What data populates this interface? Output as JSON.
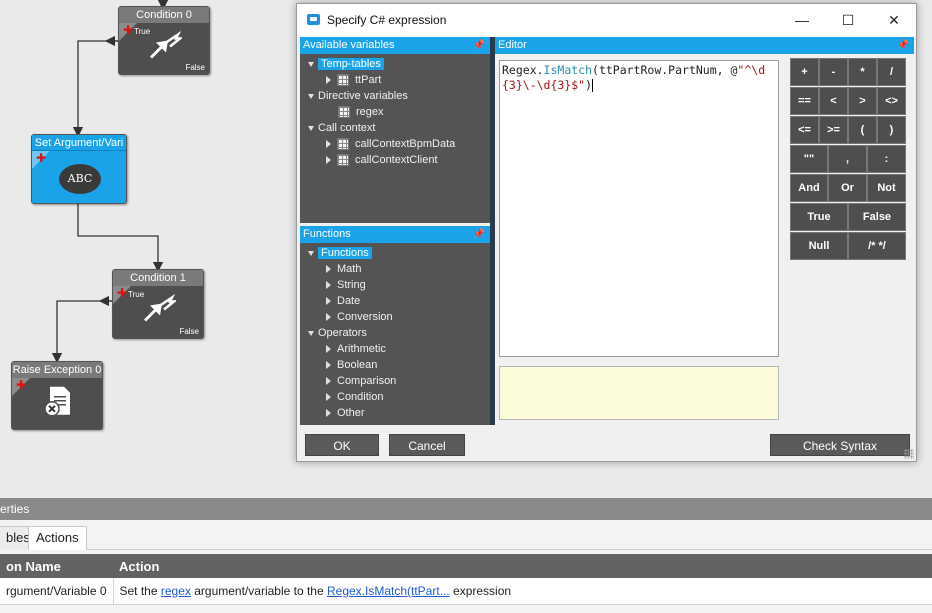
{
  "canvas": {
    "nodes": {
      "condition0": {
        "title": "Condition 0",
        "true_label": "True",
        "false_label": "False"
      },
      "set_argument": {
        "title": "Set Argument/Vari",
        "icon_text": "ABC"
      },
      "condition1": {
        "title": "Condition 1",
        "true_label": "True",
        "false_label": "False"
      },
      "raise_exception": {
        "title": "Raise Exception 0"
      }
    }
  },
  "dialog": {
    "title": "Specify C# expression",
    "window_controls": {
      "minimize": "—",
      "maximize": "☐",
      "close": "✕"
    },
    "available_variables": {
      "header": "Available variables",
      "items": {
        "temp_tables": "Temp-tables",
        "ttpart": "ttPart",
        "directive_variables": "Directive variables",
        "regex": "regex",
        "call_context": "Call context",
        "call_context_bpm": "callContextBpmData",
        "call_context_client": "callContextClient"
      }
    },
    "functions": {
      "header": "Functions",
      "root": "Functions",
      "function_items": [
        "Math",
        "String",
        "Date",
        "Conversion"
      ],
      "operators_label": "Operators",
      "operator_items": [
        "Arithmetic",
        "Boolean",
        "Comparison",
        "Condition",
        "Other"
      ]
    },
    "editor": {
      "header": "Editor",
      "code_prefix": "Regex.",
      "code_method": "IsMatch",
      "code_args": "(ttPartRow.PartNum, @",
      "code_string": "\"^\\d{3}\\-\\d{3}$\"",
      "code_suffix": ")"
    },
    "keypad": {
      "row1": [
        "+",
        "-",
        "*",
        "/"
      ],
      "row2": [
        "==",
        "<",
        ">",
        "<>"
      ],
      "row3": [
        "<=",
        ">=",
        "(",
        ")"
      ],
      "row4": [
        "\"\"",
        ",",
        ":"
      ],
      "row5": [
        "And",
        "Or",
        "Not"
      ],
      "row6": [
        "True",
        "False"
      ],
      "row7": [
        "Null",
        "/* */"
      ]
    },
    "buttons": {
      "ok": "OK",
      "cancel": "Cancel",
      "check_syntax": "Check Syntax"
    }
  },
  "properties": {
    "header": "erties",
    "tabs": [
      "bles",
      "Actions"
    ],
    "table": {
      "columns": [
        "on Name",
        "Action"
      ],
      "row": {
        "name": "rgument/Variable 0",
        "action_prefix": "Set the ",
        "action_link1": "regex",
        "action_mid": " argument/variable to the ",
        "action_link2": "Regex.IsMatch(ttPart...",
        "action_suffix": " expression"
      }
    }
  },
  "colors": {
    "accent": "#1aa3e8",
    "node_dark": "#4e4e4e",
    "pane": "#545454",
    "link": "#1d5bd6"
  }
}
